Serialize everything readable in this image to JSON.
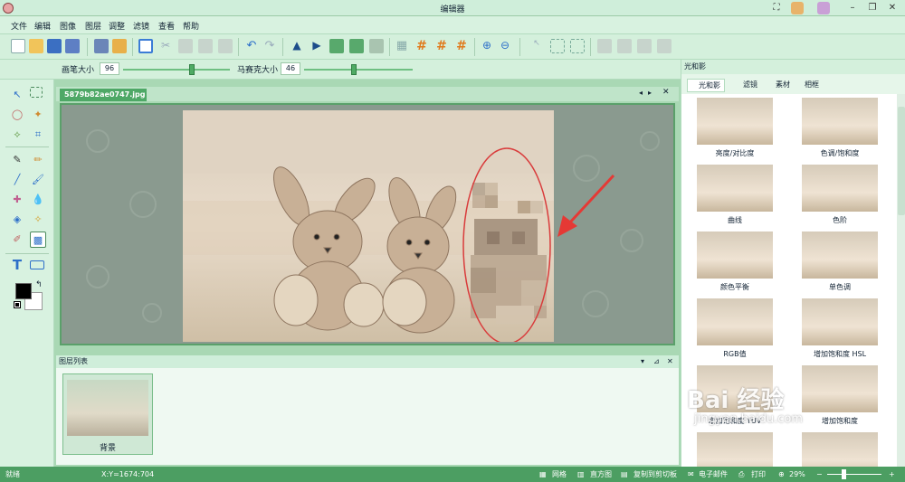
{
  "window": {
    "title": "编辑器"
  },
  "menu": [
    "文件",
    "编辑",
    "图像",
    "图层",
    "调整",
    "滤镜",
    "查看",
    "帮助"
  ],
  "options": {
    "brush_label": "画笔大小",
    "brush_value": "96",
    "brush_level": 0.65,
    "mosaic_label": "马赛克大小",
    "mosaic_value": "46",
    "mosaic_level": 0.46
  },
  "doc": {
    "tab": "5879b82ae0747.jpg *"
  },
  "layers": {
    "title": "图层列表",
    "items": [
      {
        "label": "背景"
      }
    ]
  },
  "right_panel": {
    "title": "光和影",
    "tabs": [
      "光和影",
      "滤镜",
      "素材",
      "相框"
    ],
    "effects": [
      "亮度/对比度",
      "色调/饱和度",
      "曲线",
      "色阶",
      "颜色平衡",
      "单色调",
      "RGB值",
      "增加饱和度 HSL",
      "增加饱和度 YUV",
      "增加饱和度"
    ]
  },
  "status": {
    "ready": "就绪",
    "coords": "X:Y=1674:704",
    "grid": "网格",
    "histogram": "直方图",
    "copy": "复制到剪切板",
    "email": "电子邮件",
    "print": "打印",
    "zoom": "29%"
  },
  "colors": {
    "accent": "#4ea866",
    "ellipse": "#d93b3b",
    "foreground": "#000000",
    "background": "#ffffff"
  },
  "watermark": {
    "brand": "Bai 经验",
    "url": "jingyan.baidu.com"
  }
}
